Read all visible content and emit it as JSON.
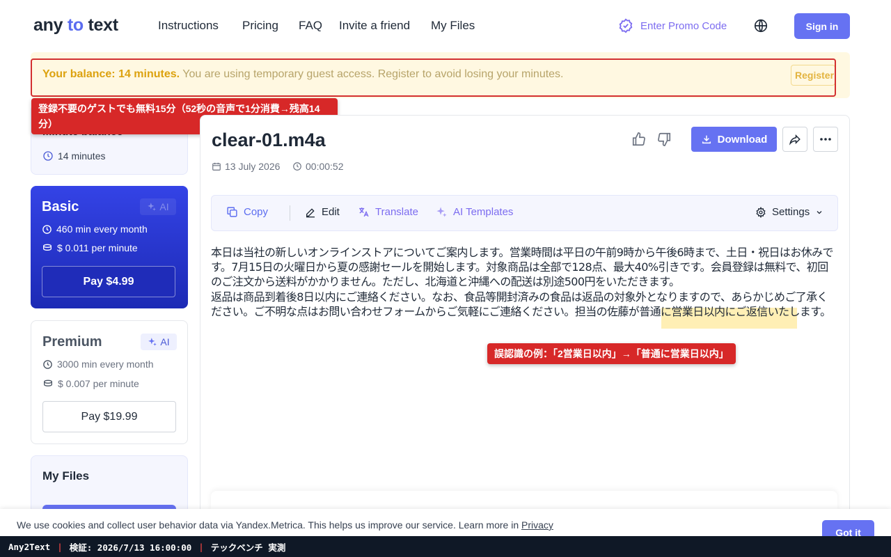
{
  "header": {
    "logo": {
      "part1": "any",
      "part2": "to",
      "part3": "text"
    },
    "nav": [
      "Instructions",
      "Pricing",
      "FAQ",
      "Invite a friend",
      "My Files"
    ],
    "promo_label": "Enter Promo Code",
    "signin_label": "Sign in"
  },
  "banner": {
    "balance_strong": "Your balance: 14 minutes.",
    "message": " You are using temporary guest access. Register to avoid losing your minutes.",
    "register_label": "Register"
  },
  "annotations": {
    "guest_note": "登録不要のゲストでも無料15分（52秒の音声で1分消費→残高14分）",
    "error_note": "誤認識の例：「2営業日以内」→「普通に営業日以内」"
  },
  "sidebar": {
    "balance_card": {
      "title": "Minute balance",
      "value": "14 minutes"
    },
    "basic": {
      "title": "Basic",
      "ai": "AI",
      "minutes": "460 min every month",
      "price": "$ 0.011 per minute",
      "pay": "Pay  $4.99"
    },
    "premium": {
      "title": "Premium",
      "ai": "AI",
      "minutes": "3000 min every month",
      "price": "$ 0.007 per minute",
      "pay": "Pay  $19.99"
    },
    "files_title": "My Files"
  },
  "file": {
    "name": "clear-01.m4a",
    "date": "13 July 2026",
    "duration": "00:00:52",
    "download_label": "Download"
  },
  "toolbar": {
    "copy": "Copy",
    "edit": "Edit",
    "translate": "Translate",
    "ai_templates": "AI Templates",
    "settings": "Settings"
  },
  "transcript": {
    "para1": "本日は当社の新しいオンラインストアについてご案内します。営業時間は平日の午前9時から午後6時まで、土日・祝日はお休みです。7月15日の火曜日から夏の感謝セールを開始します。対象商品は全部で128点、最大40%引きです。会員登録は無料で、初回のご注文から送料がかかりません。ただし、北海道と沖縄への配送は別途500円をいただきます。",
    "para2": "返品は商品到着後8日以内にご連絡ください。なお、食品等開封済みの食品は返品の対象外となりますので、あらかじめご了承ください。ご不明な点はお問い合わせフォームからご気軽にご連絡ください。担当の佐藤が普通に営業日以内にご返信いたします。"
  },
  "cookie": {
    "text": "We use cookies and collect user behavior data via Yandex.Metrica. This helps us improve our service. Learn more in ",
    "link": "Privacy",
    "button": "Got it"
  },
  "status": {
    "app": "Any2Text",
    "verify": "検証: 2026/7/13 16:00:00",
    "source": "テックベンチ 実測"
  },
  "colors": {
    "accent": "#6672f2",
    "annotation_red": "#d72828",
    "banner_bg": "#fff8e1",
    "basic_card": "#2a38d0"
  }
}
